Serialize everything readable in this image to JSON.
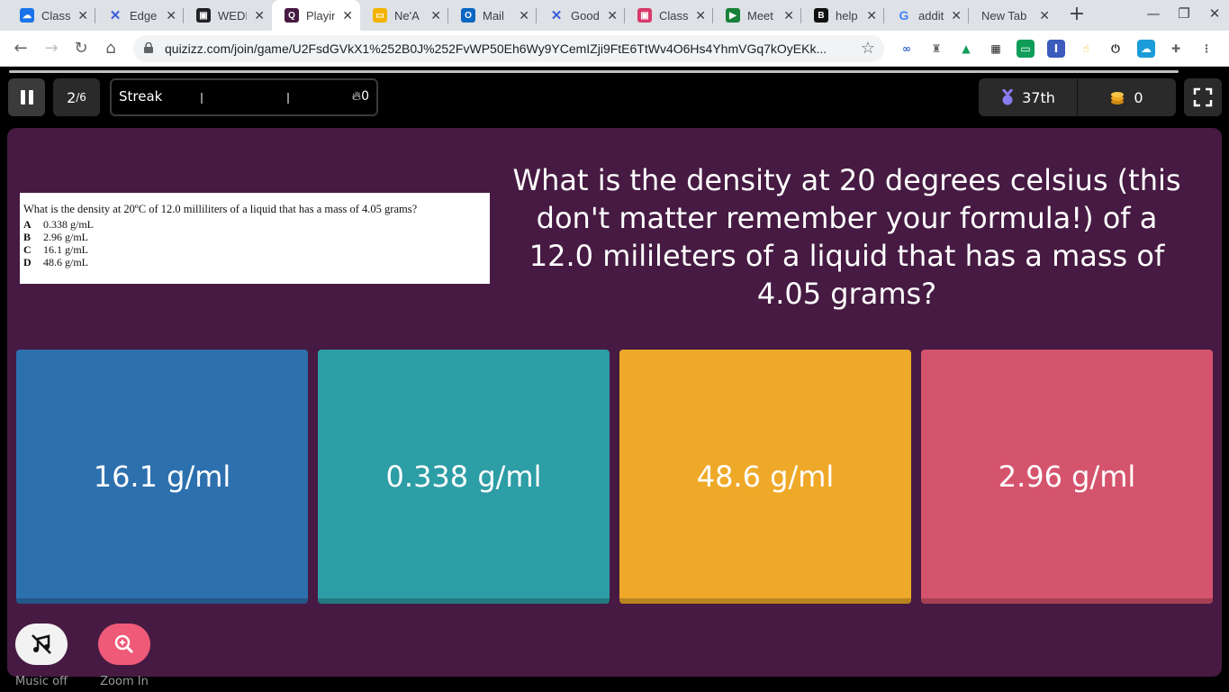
{
  "browser": {
    "tabs": [
      {
        "label": "Class",
        "color": "#1a73e8",
        "glyph": "☁"
      },
      {
        "label": "Edge",
        "color": "#3b5bdb",
        "glyph": "✕"
      },
      {
        "label": "WEDI",
        "color": "#202124",
        "glyph": "▣"
      },
      {
        "label": "Playin",
        "color": "#461a42",
        "glyph": "Q"
      },
      {
        "label": "Ne'A",
        "color": "#f4b400",
        "glyph": "▭"
      },
      {
        "label": "Mail",
        "color": "#0a66c2",
        "glyph": "O"
      },
      {
        "label": "Good",
        "color": "#3b5bdb",
        "glyph": "✕"
      },
      {
        "label": "Class",
        "color": "#d93a6b",
        "glyph": "▣"
      },
      {
        "label": "Meet",
        "color": "#188038",
        "glyph": "▶"
      },
      {
        "label": "help",
        "color": "#111111",
        "glyph": "B"
      },
      {
        "label": "addit",
        "color": "#4285f4",
        "glyph": "G"
      },
      {
        "label": "New Tab",
        "color": "",
        "glyph": ""
      }
    ],
    "close_glyph": "✕",
    "new_tab_glyph": "+",
    "url": "quizizz.com/join/game/U2FsdGVkX1%252B0J%252FvWP50Eh6Wy9YCemIZji9FtE6TtWv4O6Hs4YhmVGq7kOyEKk..."
  },
  "topbar": {
    "question_current": "2",
    "question_total": "/6",
    "streak_label": "Streak",
    "streak_count": "0",
    "rank": "37th",
    "coins": "0"
  },
  "question": {
    "text": "What is the density at 20 degrees celsius (this don't matter remember your formula!) of a 12.0 milileters of a liquid that has a mass of 4.05 grams?",
    "image": {
      "question_line": "What is the density at 20ºC of 12.0 milliliters of a liquid that has a mass of 4.05 grams?",
      "options": [
        {
          "letter": "A",
          "text": "0.338 g/mL"
        },
        {
          "letter": "B",
          "text": "2.96 g/mL"
        },
        {
          "letter": "C",
          "text": "16.1 g/mL"
        },
        {
          "letter": "D",
          "text": "48.6 g/mL"
        }
      ]
    }
  },
  "answers": [
    {
      "label": "16.1 g/ml",
      "color": "#2d70ae"
    },
    {
      "label": "0.338 g/ml",
      "color": "#2d9da6"
    },
    {
      "label": "48.6 g/ml",
      "color": "#efa929"
    },
    {
      "label": "2.96 g/ml",
      "color": "#d5546d"
    }
  ],
  "bottom": {
    "music_label": "Music off",
    "zoom_label": "Zoom In"
  }
}
